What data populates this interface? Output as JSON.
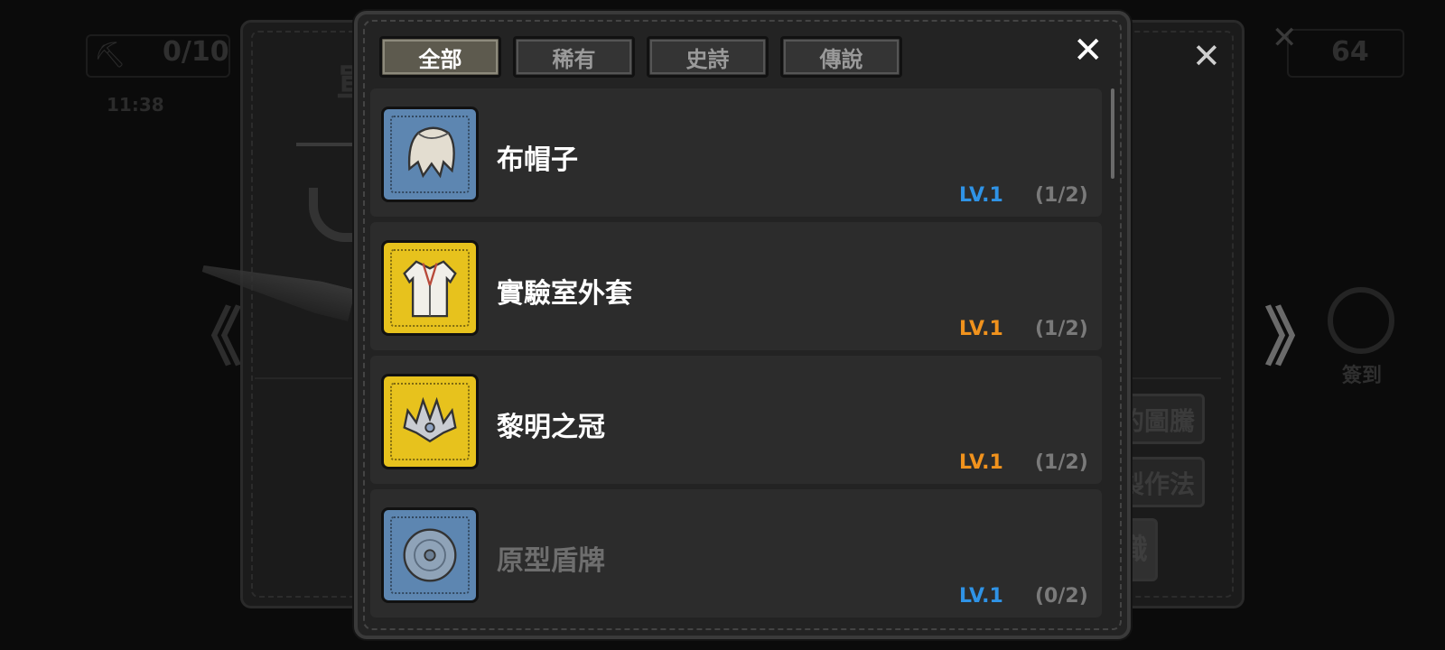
{
  "background": {
    "counter": "0/10",
    "timer": "11:38",
    "right_counter": "64",
    "title_glyph": "單",
    "checkin_label": "簽到",
    "buttons": {
      "totem": "的圖騰",
      "recipe": "製作法",
      "equip": "識"
    },
    "nav_prev": "《",
    "nav_next": "》",
    "close_symbol": "✕"
  },
  "modal": {
    "tabs": [
      {
        "label": "全部",
        "active": true
      },
      {
        "label": "稀有",
        "active": false
      },
      {
        "label": "史詩",
        "active": false
      },
      {
        "label": "傳說",
        "active": false
      }
    ],
    "close_symbol": "✕",
    "items": [
      {
        "name": "布帽子",
        "level": "LV.1",
        "count": "(1/2)",
        "rarity": "blue",
        "icon": "cloth-hat-icon",
        "unlocked": true
      },
      {
        "name": "實驗室外套",
        "level": "LV.1",
        "count": "(1/2)",
        "rarity": "gold",
        "icon": "lab-coat-icon",
        "unlocked": true
      },
      {
        "name": "黎明之冠",
        "level": "LV.1",
        "count": "(1/2)",
        "rarity": "gold",
        "icon": "crown-icon",
        "unlocked": true
      },
      {
        "name": "原型盾牌",
        "level": "LV.1",
        "count": "(0/2)",
        "rarity": "blue",
        "icon": "round-shield-icon",
        "unlocked": false
      }
    ]
  },
  "colors": {
    "rare_blue": "#5d86b1",
    "legend_gold": "#e7c21d",
    "level_blue": "#2f93e6",
    "level_orange": "#f0921d",
    "active_tab": "#5d5a4e"
  }
}
